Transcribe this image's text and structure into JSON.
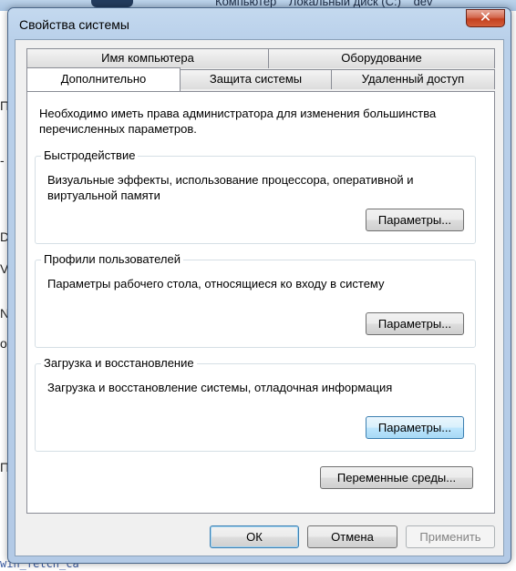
{
  "background": {
    "breadcrumb": [
      "Компьютер",
      "Локальный диск (C:)",
      "dev"
    ],
    "side_letters": [
      "П",
      "-",
      "D",
      "V",
      "N",
      "o",
      "П"
    ],
    "bottom_text": "win_fetch_ca"
  },
  "dialog": {
    "title": "Свойства системы",
    "close_glyph": "✕",
    "tabs_back": [
      "Имя компьютера",
      "Оборудование"
    ],
    "tabs_front": [
      "Дополнительно",
      "Защита системы",
      "Удаленный доступ"
    ],
    "active_tab": "Дополнительно",
    "intro": "Необходимо иметь права администратора для изменения большинства перечисленных параметров.",
    "groups": {
      "performance": {
        "title": "Быстродействие",
        "desc": "Визуальные эффекты, использование процессора, оперативной и виртуальной памяти",
        "button": "Параметры..."
      },
      "profiles": {
        "title": "Профили пользователей",
        "desc": "Параметры рабочего стола, относящиеся ко входу в систему",
        "button": "Параметры..."
      },
      "startup": {
        "title": "Загрузка и восстановление",
        "desc": "Загрузка и восстановление системы, отладочная информация",
        "button": "Параметры..."
      }
    },
    "env_button": "Переменные среды...",
    "footer": {
      "ok": "ОК",
      "cancel": "Отмена",
      "apply": "Применить"
    }
  }
}
